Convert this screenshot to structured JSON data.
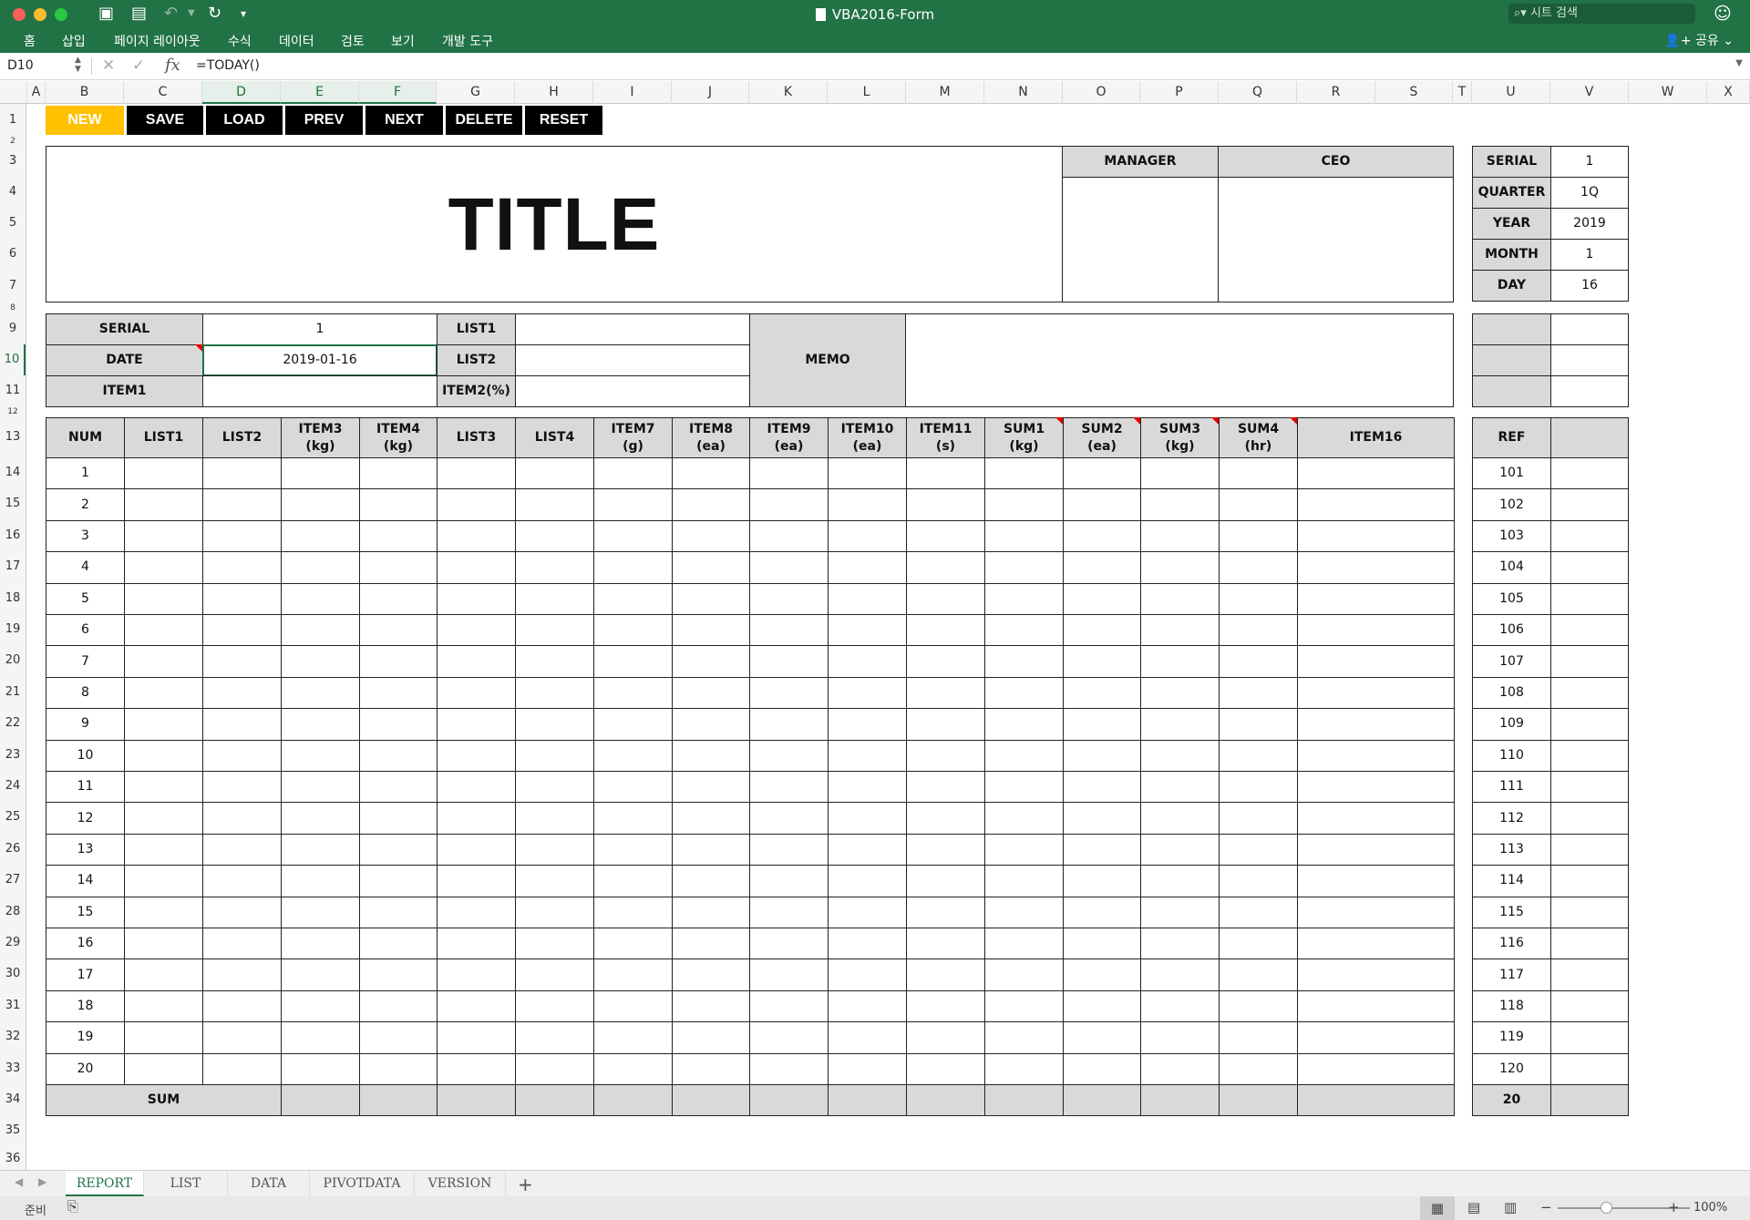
{
  "window": {
    "title": "VBA2016-Form",
    "search_placeholder": "시트 검색"
  },
  "ribbon": {
    "tabs": [
      "홈",
      "삽입",
      "페이지 레이아웃",
      "수식",
      "데이터",
      "검토",
      "보기",
      "개발 도구"
    ],
    "share": "공유"
  },
  "formula_bar": {
    "name_box": "D10",
    "formula": "=TODAY()",
    "fx": "fx"
  },
  "columns": [
    "A",
    "B",
    "C",
    "D",
    "E",
    "F",
    "G",
    "H",
    "I",
    "J",
    "K",
    "L",
    "M",
    "N",
    "O",
    "P",
    "Q",
    "R",
    "S",
    "T",
    "U",
    "V",
    "W",
    "X"
  ],
  "rows": [
    "1",
    "2",
    "3",
    "4",
    "5",
    "6",
    "7",
    "8",
    "9",
    "10",
    "11",
    "12",
    "13",
    "14",
    "15",
    "16",
    "17",
    "18",
    "19",
    "20",
    "21",
    "22",
    "23",
    "24",
    "25",
    "26",
    "27",
    "28",
    "29",
    "30",
    "31",
    "32",
    "33",
    "34",
    "35",
    "36"
  ],
  "buttons": [
    "NEW",
    "SAVE",
    "LOAD",
    "PREV",
    "NEXT",
    "DELETE",
    "RESET"
  ],
  "title": "TITLE",
  "approval": {
    "manager": "MANAGER",
    "ceo": "CEO"
  },
  "side_info": [
    {
      "label": "SERIAL",
      "value": "1"
    },
    {
      "label": "QUARTER",
      "value": "1Q"
    },
    {
      "label": "YEAR",
      "value": "2019"
    },
    {
      "label": "MONTH",
      "value": "1"
    },
    {
      "label": "DAY",
      "value": "16"
    }
  ],
  "info": {
    "serial_label": "SERIAL",
    "serial_value": "1",
    "date_label": "DATE",
    "date_value": "2019-01-16",
    "item1_label": "ITEM1",
    "item1_value": "",
    "list1_label": "LIST1",
    "list2_label": "LIST2",
    "item2_label": "ITEM2(%)",
    "memo_label": "MEMO"
  },
  "table": {
    "headers": [
      {
        "l1": "NUM",
        "l2": ""
      },
      {
        "l1": "LIST1",
        "l2": ""
      },
      {
        "l1": "LIST2",
        "l2": ""
      },
      {
        "l1": "ITEM3",
        "l2": "(kg)"
      },
      {
        "l1": "ITEM4",
        "l2": "(kg)"
      },
      {
        "l1": "LIST3",
        "l2": ""
      },
      {
        "l1": "LIST4",
        "l2": ""
      },
      {
        "l1": "ITEM7",
        "l2": "(g)"
      },
      {
        "l1": "ITEM8",
        "l2": "(ea)"
      },
      {
        "l1": "ITEM9",
        "l2": "(ea)"
      },
      {
        "l1": "ITEM10",
        "l2": "(ea)"
      },
      {
        "l1": "ITEM11",
        "l2": "(s)"
      },
      {
        "l1": "SUM1",
        "l2": "(kg)"
      },
      {
        "l1": "SUM2",
        "l2": "(ea)"
      },
      {
        "l1": "SUM3",
        "l2": "(kg)"
      },
      {
        "l1": "SUM4",
        "l2": "(hr)"
      },
      {
        "l1": "ITEM16",
        "l2": ""
      }
    ],
    "nums": [
      "1",
      "2",
      "3",
      "4",
      "5",
      "6",
      "7",
      "8",
      "9",
      "10",
      "11",
      "12",
      "13",
      "14",
      "15",
      "16",
      "17",
      "18",
      "19",
      "20"
    ],
    "sum_label": "SUM"
  },
  "ref": {
    "header": "REF",
    "values": [
      "101",
      "102",
      "103",
      "104",
      "105",
      "106",
      "107",
      "108",
      "109",
      "110",
      "111",
      "112",
      "113",
      "114",
      "115",
      "116",
      "117",
      "118",
      "119",
      "120"
    ],
    "total": "20"
  },
  "sheets": [
    "REPORT",
    "LIST",
    "DATA",
    "PIVOTDATA",
    "VERSION"
  ],
  "active_sheet": "REPORT",
  "status": {
    "ready": "준비",
    "zoom": "100%"
  },
  "colors": {
    "accent": "#217346",
    "active_button": "#ffc000",
    "header_fill": "#d9d9d9",
    "comment_marker": "#e00000"
  }
}
